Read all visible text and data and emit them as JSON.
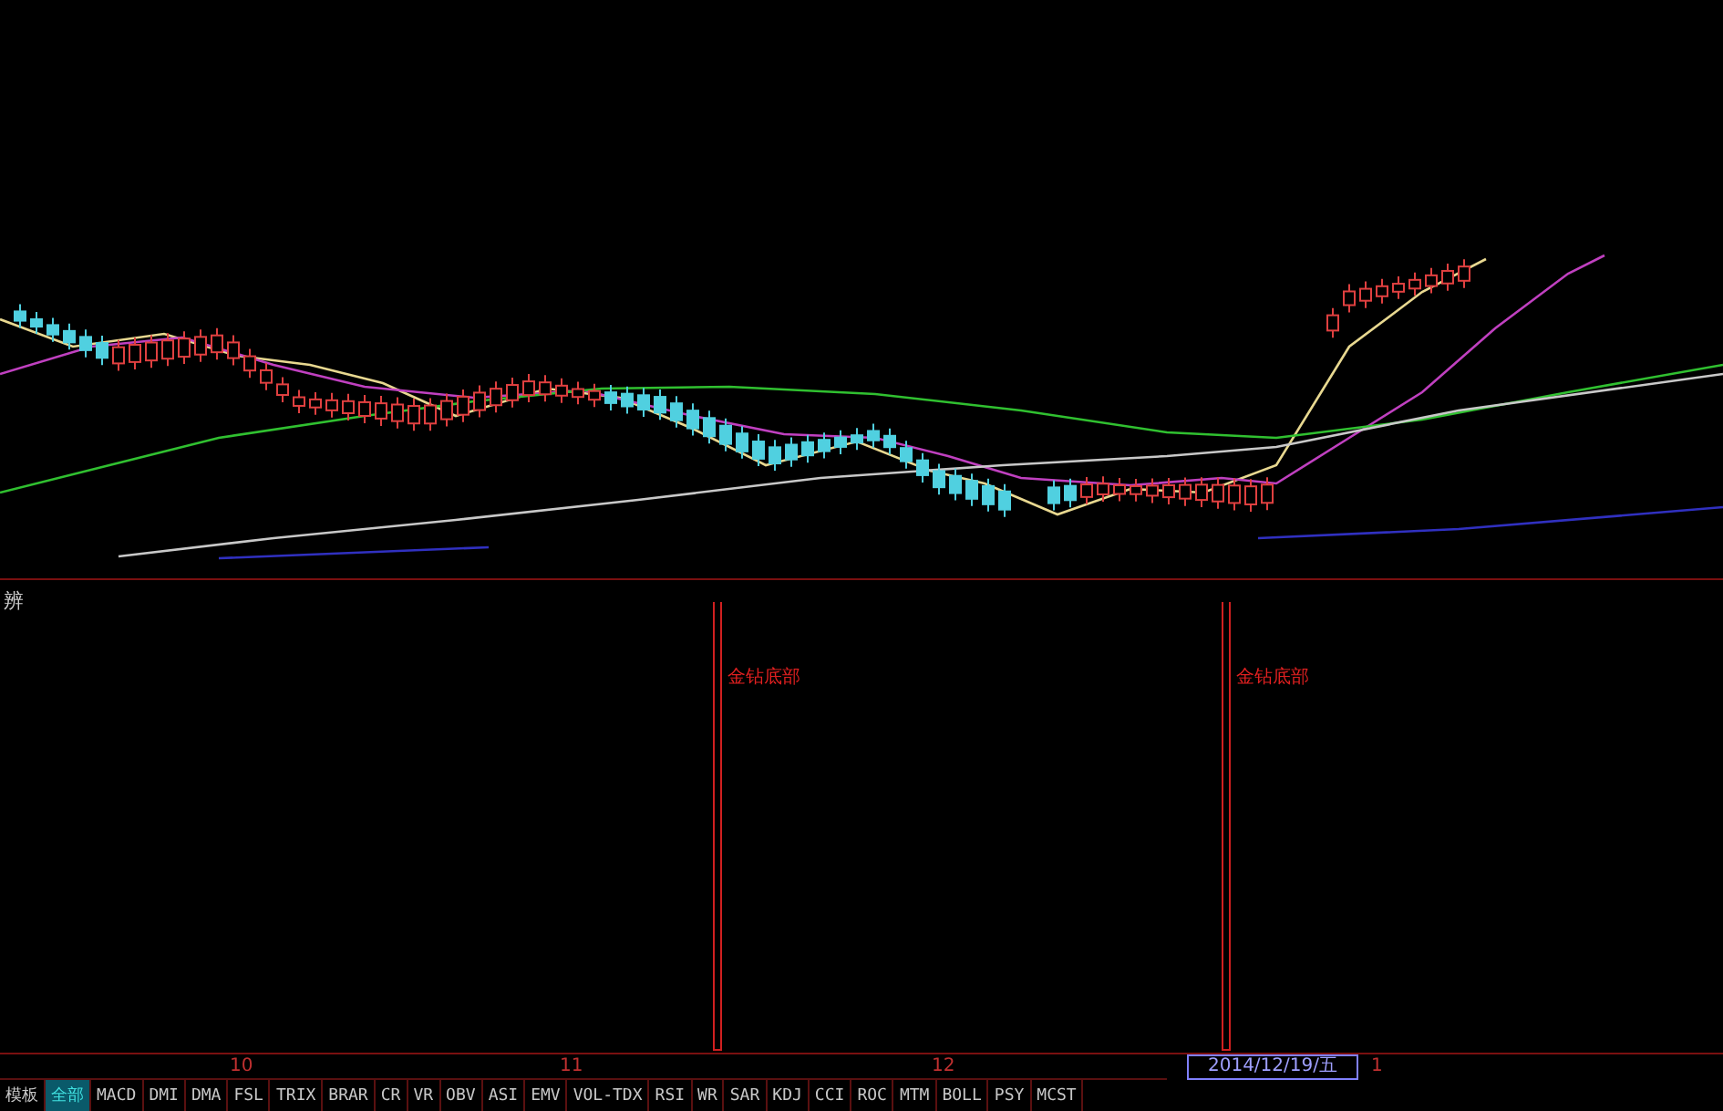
{
  "indicator_panel": {
    "label": "辨",
    "signals": [
      {
        "label": "金钻底部"
      },
      {
        "label": "金钻底部"
      }
    ]
  },
  "time_axis": {
    "ticks": [
      "10",
      "11",
      "12"
    ],
    "cursor_date": "2014/12/19/五",
    "end_tick": "1"
  },
  "tabs": [
    {
      "label": "模板",
      "selected": false
    },
    {
      "label": "全部",
      "selected": true
    },
    {
      "label": "MACD",
      "selected": false
    },
    {
      "label": "DMI",
      "selected": false
    },
    {
      "label": "DMA",
      "selected": false
    },
    {
      "label": "FSL",
      "selected": false
    },
    {
      "label": "TRIX",
      "selected": false
    },
    {
      "label": "BRAR",
      "selected": false
    },
    {
      "label": "CR",
      "selected": false
    },
    {
      "label": "VR",
      "selected": false
    },
    {
      "label": "OBV",
      "selected": false
    },
    {
      "label": "ASI",
      "selected": false
    },
    {
      "label": "EMV",
      "selected": false
    },
    {
      "label": "VOL-TDX",
      "selected": false
    },
    {
      "label": "RSI",
      "selected": false
    },
    {
      "label": "WR",
      "selected": false
    },
    {
      "label": "SAR",
      "selected": false
    },
    {
      "label": "KDJ",
      "selected": false
    },
    {
      "label": "CCI",
      "selected": false
    },
    {
      "label": "ROC",
      "selected": false
    },
    {
      "label": "MTM",
      "selected": false
    },
    {
      "label": "BOLL",
      "selected": false
    },
    {
      "label": "PSY",
      "selected": false
    },
    {
      "label": "MCST",
      "selected": false
    }
  ]
}
